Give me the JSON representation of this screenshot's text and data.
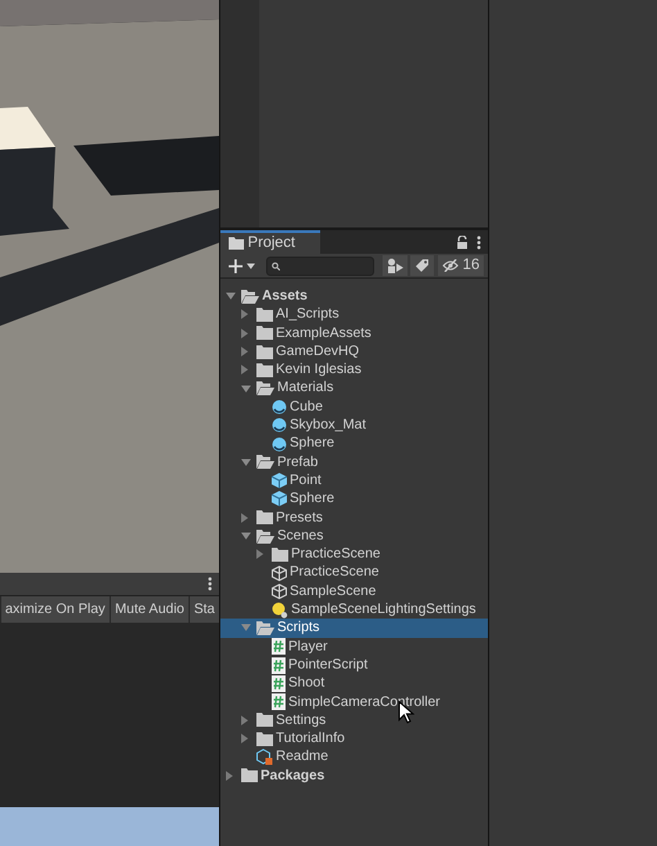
{
  "game_toolbar": {
    "buttons": [
      {
        "label": "aximize On Play"
      },
      {
        "label": "Mute Audio"
      },
      {
        "label": "Sta"
      }
    ]
  },
  "project": {
    "tab": {
      "label": "Project",
      "selected": true
    },
    "hidden_count": "16",
    "tree": [
      {
        "label": "Assets",
        "kind": "folder",
        "expanded": true,
        "selected": false,
        "children": [
          {
            "label": "AI_Scripts",
            "kind": "folder",
            "expanded": false,
            "selected": false
          },
          {
            "label": "ExampleAssets",
            "kind": "folder",
            "expanded": false,
            "selected": false
          },
          {
            "label": "GameDevHQ",
            "kind": "folder",
            "expanded": false,
            "selected": false
          },
          {
            "label": "Kevin Iglesias",
            "kind": "folder",
            "expanded": false,
            "selected": false
          },
          {
            "label": "Materials",
            "kind": "folder",
            "expanded": true,
            "selected": false,
            "children": [
              {
                "label": "Cube",
                "kind": "material",
                "selected": false
              },
              {
                "label": "Skybox_Mat",
                "kind": "material",
                "selected": false
              },
              {
                "label": "Sphere",
                "kind": "material",
                "selected": false
              }
            ]
          },
          {
            "label": "Prefab",
            "kind": "folder",
            "expanded": true,
            "selected": false,
            "children": [
              {
                "label": "Point",
                "kind": "prefab",
                "selected": false
              },
              {
                "label": "Sphere",
                "kind": "prefab",
                "selected": false
              }
            ]
          },
          {
            "label": "Presets",
            "kind": "folder",
            "expanded": false,
            "selected": false
          },
          {
            "label": "Scenes",
            "kind": "folder",
            "expanded": true,
            "selected": false,
            "children": [
              {
                "label": "PracticeScene",
                "kind": "folder",
                "expanded": false,
                "selected": false
              },
              {
                "label": "PracticeScene",
                "kind": "scene",
                "selected": false
              },
              {
                "label": "SampleScene",
                "kind": "scene",
                "selected": false
              },
              {
                "label": "SampleSceneLightingSettings",
                "kind": "lighting",
                "selected": false
              }
            ]
          },
          {
            "label": "Scripts",
            "kind": "folder",
            "expanded": true,
            "selected": true,
            "children": [
              {
                "label": "Player",
                "kind": "script",
                "selected": false
              },
              {
                "label": "PointerScript",
                "kind": "script",
                "selected": false
              },
              {
                "label": "Shoot",
                "kind": "script",
                "selected": false
              },
              {
                "label": "SimpleCameraController",
                "kind": "script",
                "selected": false
              }
            ]
          },
          {
            "label": "Settings",
            "kind": "folder",
            "expanded": false,
            "selected": false
          },
          {
            "label": "TutorialInfo",
            "kind": "folder",
            "expanded": false,
            "selected": false
          },
          {
            "label": "Readme",
            "kind": "readme",
            "selected": false
          }
        ]
      },
      {
        "label": "Packages",
        "kind": "folder",
        "expanded": false,
        "selected": false
      }
    ]
  }
}
